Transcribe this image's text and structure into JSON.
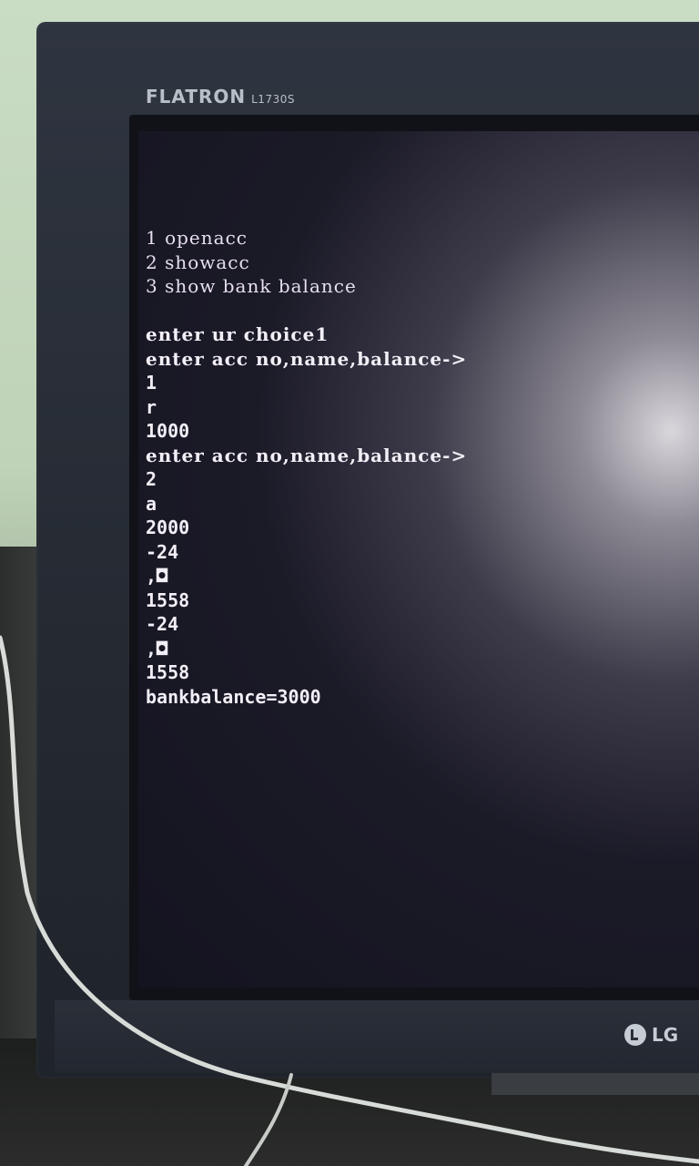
{
  "monitor": {
    "brand": "FLATRON",
    "model": "L1730S",
    "maker": "LG"
  },
  "terminal": {
    "menu": [
      "1 openacc",
      "2 showacc",
      "3 show bank balance"
    ],
    "lines": [
      "enter ur choice1",
      "enter acc no,name,balance->",
      "1",
      "r",
      "1000",
      "enter acc no,name,balance->",
      "2",
      "a",
      "2000",
      "-24",
      ",◘",
      "1558",
      "-24",
      ",◘",
      "1558",
      "bankbalance=3000"
    ]
  },
  "colors": {
    "screen_text": "#f2eef6",
    "bezel": "#2a2f38"
  }
}
